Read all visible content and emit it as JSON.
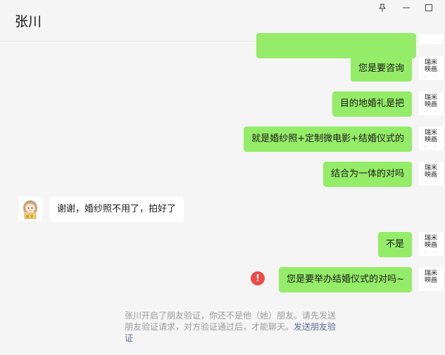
{
  "window": {
    "title": "张川",
    "pin_icon": "pin-icon",
    "minimize_icon": "minimize-icon",
    "maximize_icon": "maximize-icon"
  },
  "avatar_me": {
    "line1": "瑞米",
    "line2": "映画",
    "small": "— ·· —"
  },
  "messages": [
    {
      "from": "me",
      "text": "您是要咨询"
    },
    {
      "from": "me",
      "text": "目的地婚礼是把"
    },
    {
      "from": "me",
      "text": "就是婚纱照+定制微电影+结婚仪式的"
    },
    {
      "from": "me",
      "text": "结合为一体的对吗"
    },
    {
      "from": "them",
      "text": "谢谢，婚纱照不用了，拍好了"
    },
    {
      "from": "me",
      "text": "不是"
    },
    {
      "from": "me",
      "text": "您是要举办结婚仪式的对吗~",
      "failed": true
    }
  ],
  "system_notice": {
    "text": "张川开启了朋友验证，你还不是他（她）朋友。请先发送朋友验证请求，对方验证通过后，才能聊天。",
    "link": "发送朋友验证"
  },
  "colors": {
    "bubble_out": "#95ec69",
    "bubble_in": "#ffffff",
    "error": "#f04b4b",
    "link": "#576b95"
  }
}
